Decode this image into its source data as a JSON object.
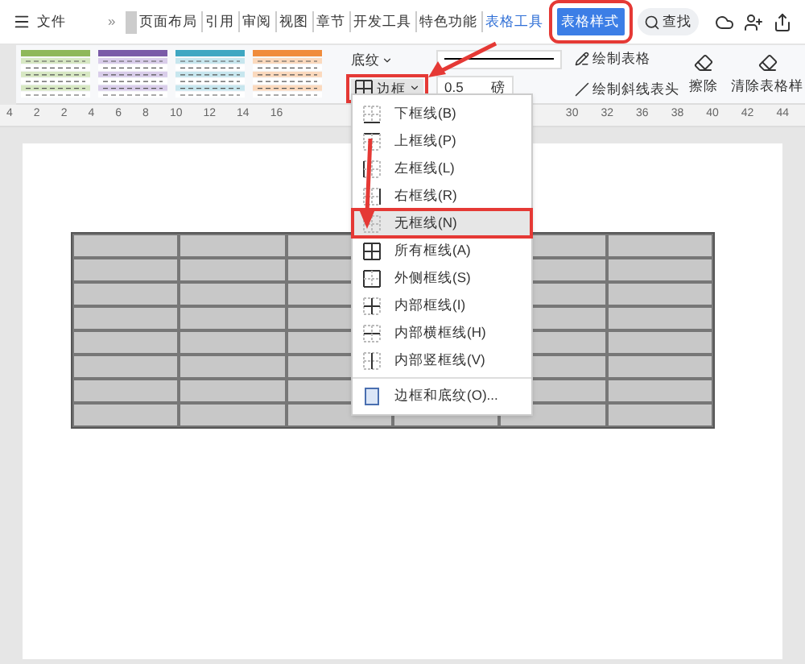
{
  "menubar": {
    "file": "文件",
    "more": "»",
    "tabs": [
      {
        "label": "页面布局",
        "selected": false
      },
      {
        "label": "引用",
        "selected": false
      },
      {
        "label": "审阅",
        "selected": false
      },
      {
        "label": "视图",
        "selected": false
      },
      {
        "label": "章节",
        "selected": false
      },
      {
        "label": "开发工具",
        "selected": false
      },
      {
        "label": "特色功能",
        "selected": false
      },
      {
        "label": "表格工具",
        "selected": false
      },
      {
        "label": "表格样式",
        "selected": true
      }
    ],
    "search": "查找"
  },
  "ribbon": {
    "shading": "底纹",
    "border": "边框",
    "line_weight": "0.5",
    "unit": "磅",
    "draw_table": "绘制表格",
    "draw_diagonal": "绘制斜线表头",
    "erase": "擦除",
    "clear_style": "清除表格样"
  },
  "ruler": [
    "4",
    "2",
    "2",
    "4",
    "6",
    "8",
    "10",
    "12",
    "14",
    "16",
    "30",
    "32",
    "36",
    "38",
    "40",
    "42",
    "44"
  ],
  "border_menu": [
    {
      "label": "下框线(B)",
      "kind": "bottom",
      "selected": false
    },
    {
      "label": "上框线(P)",
      "kind": "top",
      "selected": false
    },
    {
      "label": "左框线(L)",
      "kind": "left",
      "selected": false
    },
    {
      "label": "右框线(R)",
      "kind": "right",
      "selected": false
    },
    {
      "label": "无框线(N)",
      "kind": "none",
      "selected": true
    },
    {
      "label": "所有框线(A)",
      "kind": "all",
      "selected": false
    },
    {
      "label": "外侧框线(S)",
      "kind": "outside",
      "selected": false
    },
    {
      "label": "内部框线(I)",
      "kind": "inside",
      "selected": false
    },
    {
      "label": "内部横框线(H)",
      "kind": "inside_h",
      "selected": false
    },
    {
      "label": "内部竖框线(V)",
      "kind": "inside_v",
      "selected": false
    },
    {
      "label": "边框和底纹(O)...",
      "kind": "dialog",
      "selected": false
    }
  ]
}
